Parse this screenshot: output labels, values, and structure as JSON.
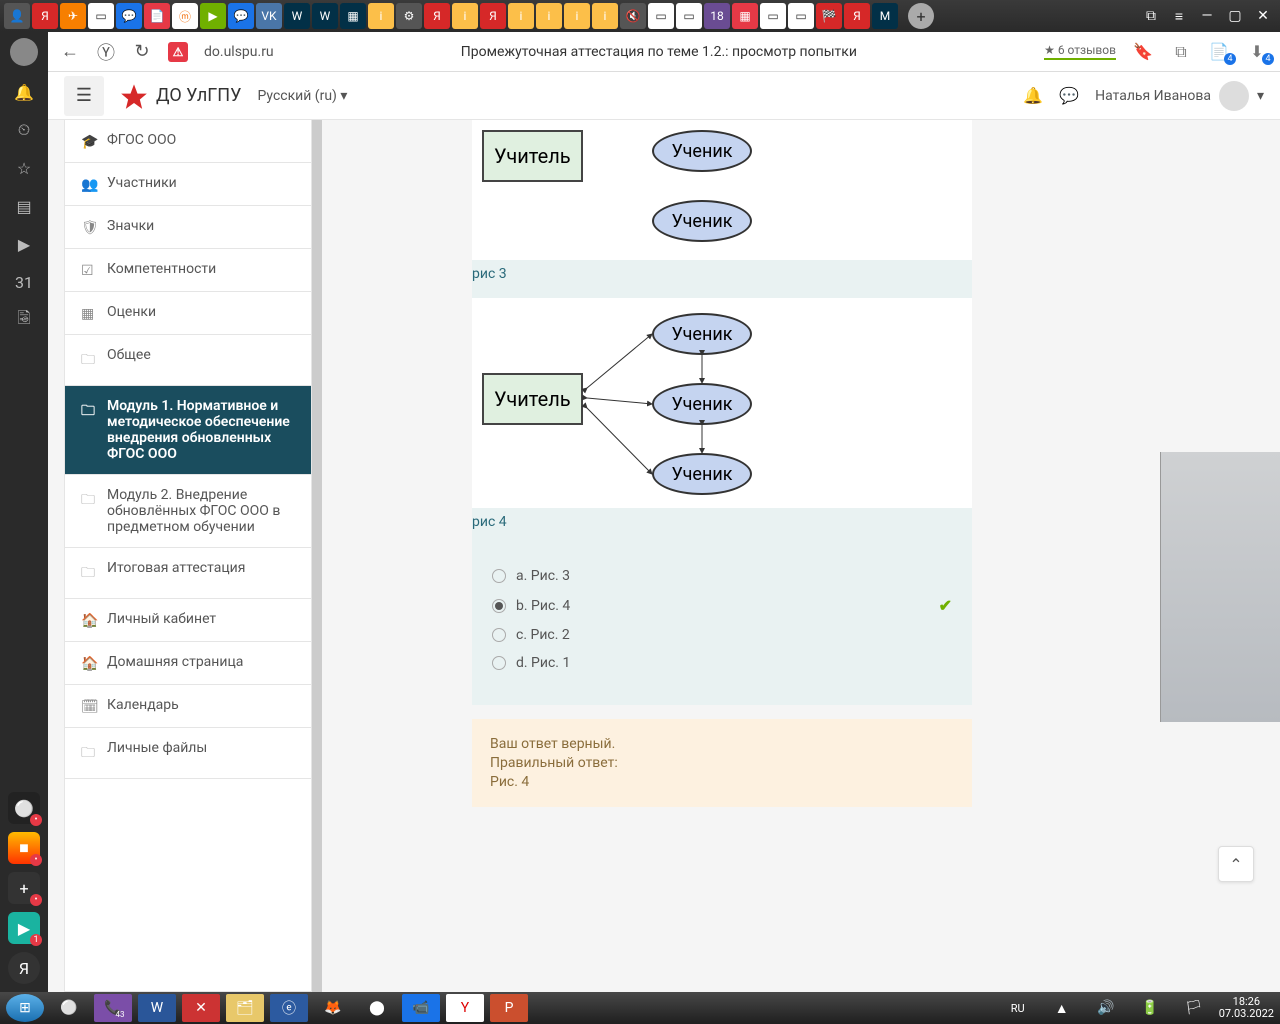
{
  "browser": {
    "url": "do.ulspu.ru",
    "page_title": "Промежуточная аттестация по теме 1.2.: просмотр попытки",
    "reviews": "★ 6 отзывов",
    "downloads_badge": "4"
  },
  "app": {
    "site_title": "ДО УлГПУ",
    "language": "Русский (ru)",
    "user_name": "Наталья Иванова"
  },
  "sidebar": {
    "items": [
      {
        "icon": "🎓",
        "label": "ФГОС ООО"
      },
      {
        "icon": "👥",
        "label": "Участники"
      },
      {
        "icon": "🛡",
        "label": "Значки"
      },
      {
        "icon": "☑",
        "label": "Компетентности"
      },
      {
        "icon": "▦",
        "label": "Оценки"
      },
      {
        "icon": "🗀",
        "label": "Общее"
      },
      {
        "icon": "🗀",
        "label": "Модуль 1. Нормативное и методическое обеспечение внедрения обновленных ФГОС ООО",
        "active": true
      },
      {
        "icon": "🗀",
        "label": "Модуль 2. Внедрение обновлённых ФГОС ООО в предметном обучении"
      },
      {
        "icon": "🗀",
        "label": "Итоговая аттестация"
      },
      {
        "icon": "🏠",
        "label": "Личный кабинет"
      },
      {
        "icon": "🏠",
        "label": "Домашняя страница"
      },
      {
        "icon": "🗓",
        "label": "Календарь"
      },
      {
        "icon": "🗀",
        "label": "Личные файлы"
      }
    ]
  },
  "quiz": {
    "teacher": "Учитель",
    "student": "Ученик",
    "caption3": "рис 3",
    "caption4": "рис 4",
    "options": {
      "a": "a. Рис. 3",
      "b": "b. Рис. 4",
      "c": "c. Рис. 2",
      "d": "d. Рис. 1"
    },
    "selected": "b",
    "feedback": {
      "line1": "Ваш ответ верный.",
      "line2": "Правильный ответ:",
      "line3": "Рис. 4"
    }
  },
  "clock": {
    "time": "18:26",
    "date": "07.03.2022",
    "lang": "RU"
  }
}
